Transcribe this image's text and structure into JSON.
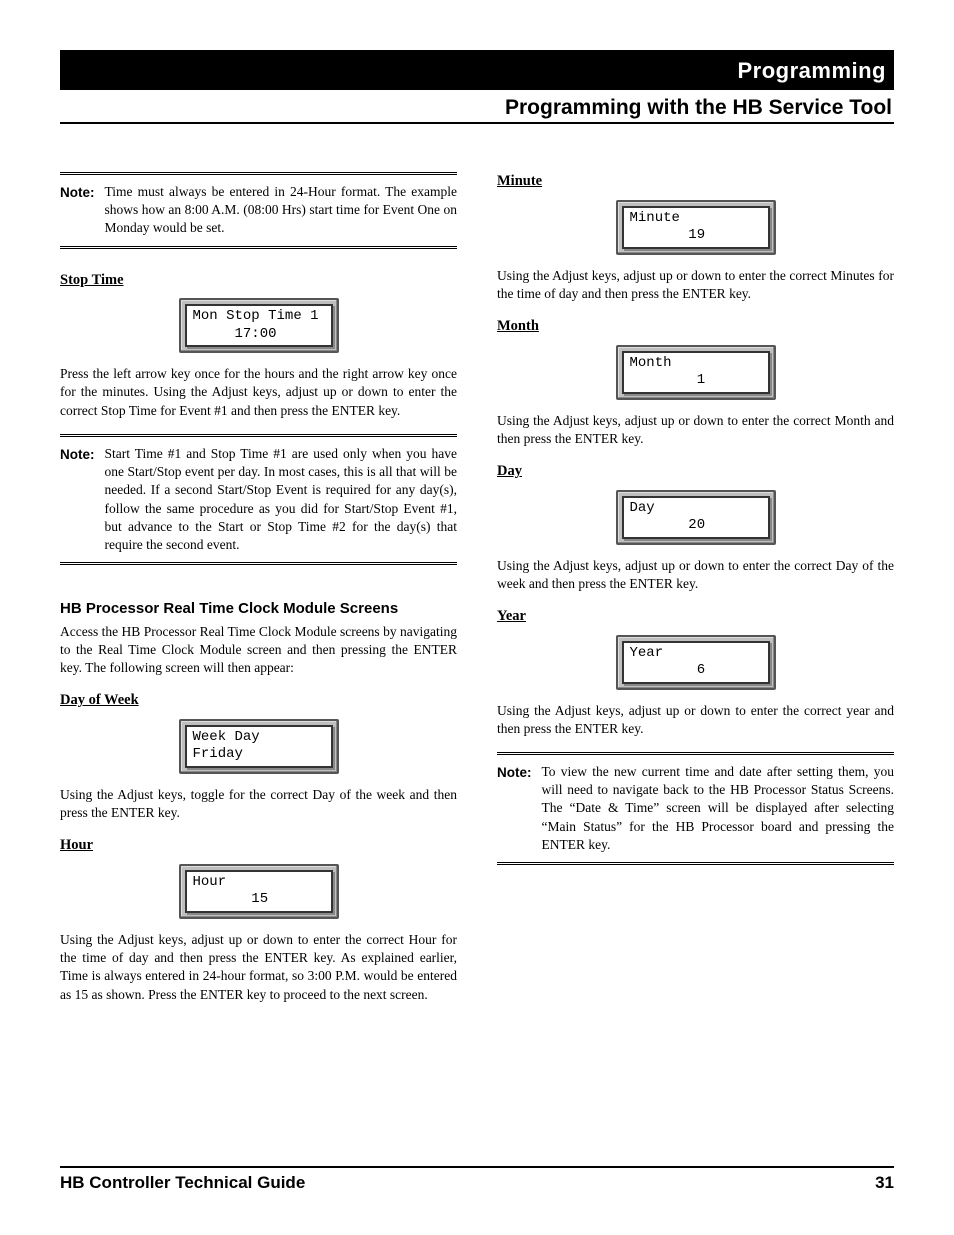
{
  "header": {
    "banner": "Programming",
    "subtitle": "Programming with the HB Service Tool"
  },
  "left": {
    "note1": {
      "label": "Note:",
      "text": "Time must always be entered in 24-Hour format. The example shows how an 8:00 A.M. (08:00 Hrs) start time for Event One on Monday would be set."
    },
    "stop_time": {
      "heading": "Stop Time",
      "lcd_line1": "Mon Stop Time 1",
      "lcd_line2": "     17:00",
      "text": "Press the left arrow key once for the hours and the right arrow key once for the minutes. Using the Adjust keys, adjust up or down to enter the correct Stop Time for Event #1 and then press the ENTER key."
    },
    "note2": {
      "label": "Note:",
      "text": "Start Time #1 and Stop Time #1 are used only when you have one Start/Stop event per day. In most cases, this is all that will be needed. If a second Start/Stop Event is required for any day(s), follow the same procedure as you did for Start/Stop Event #1, but advance to the Start or Stop Time #2 for the day(s) that require the second event."
    },
    "rtc": {
      "heading": "HB Processor Real Time Clock Module Screens",
      "intro": "Access the HB Processor Real Time Clock Module screens by navigating to the Real Time Clock Module screen and then pressing the ENTER key. The following screen will then appear:"
    },
    "day_of_week": {
      "heading": "Day of Week",
      "lcd_line1": "Week Day",
      "lcd_line2": "Friday",
      "text": "Using the Adjust keys, toggle for the correct Day of the week and then press the ENTER key."
    },
    "hour": {
      "heading": "Hour",
      "lcd_line1": "Hour",
      "lcd_line2": "       15",
      "text": "Using the Adjust keys, adjust up or down to enter the correct Hour for the time of day and then press the ENTER key.  As explained earlier, Time is always entered in 24-hour format, so 3:00 P.M. would be entered as 15 as shown. Press the ENTER key to proceed to the next screen."
    }
  },
  "right": {
    "minute": {
      "heading": "Minute",
      "lcd_line1": "Minute",
      "lcd_line2": "       19",
      "text": "Using the Adjust keys, adjust up or down to enter the correct Minutes for the time of day and then press the ENTER key."
    },
    "month": {
      "heading": "Month",
      "lcd_line1": "Month",
      "lcd_line2": "        1",
      "text": "Using the Adjust keys, adjust up or down to enter the correct Month and then press the ENTER key."
    },
    "day": {
      "heading": "Day",
      "lcd_line1": "Day",
      "lcd_line2": "       20",
      "text": "Using the Adjust keys, adjust up or down to enter the correct Day of the week and then press the ENTER key."
    },
    "year": {
      "heading": "Year",
      "lcd_line1": "Year",
      "lcd_line2": "        6",
      "text": "Using the Adjust keys, adjust up or down to enter the correct year and then press the ENTER key."
    },
    "note3": {
      "label": "Note:",
      "text": "To view the new current time and date after setting them, you will need to navigate back to the HB Processor Status Screens. The “Date & Time” screen will be displayed after selecting “Main Status” for the HB Processor board and pressing the ENTER key."
    }
  },
  "footer": {
    "title": "HB Controller Technical Guide",
    "page": "31"
  }
}
